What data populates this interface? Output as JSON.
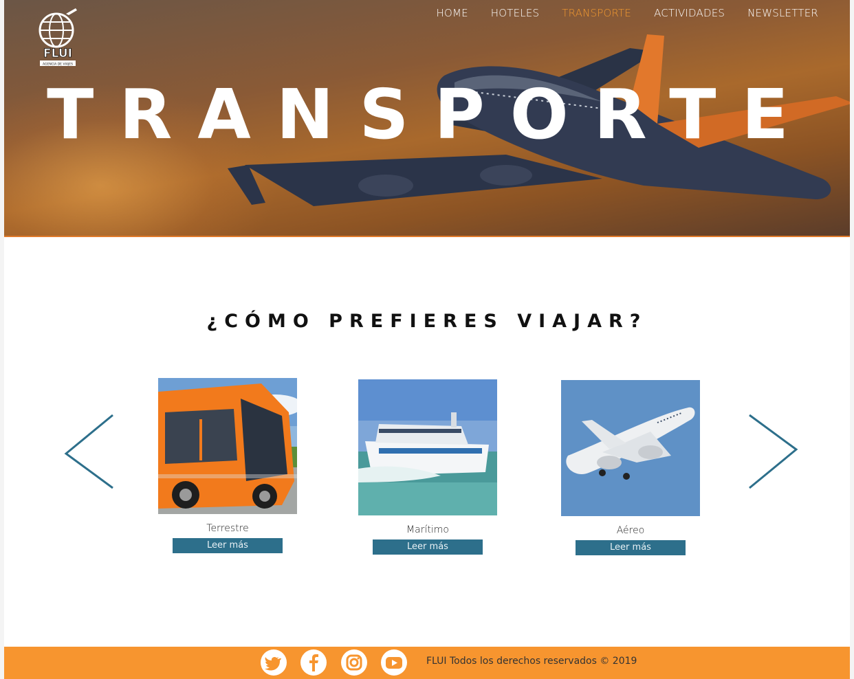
{
  "brand": {
    "name": "FLUI",
    "tagline": "AGENCIA DE VIAJES"
  },
  "nav": {
    "items": [
      {
        "label": "HOME"
      },
      {
        "label": "HOTELES"
      },
      {
        "label": "TRANSPORTE"
      },
      {
        "label": "ACTIVIDADES"
      },
      {
        "label": "NEWSLETTER"
      }
    ],
    "active_color": "#f39a30"
  },
  "hero": {
    "title": "TRANSPORTE"
  },
  "section": {
    "title": "¿CÓMO PREFIERES VIAJAR?"
  },
  "cards": [
    {
      "label": "Terrestre",
      "button": "Leer más",
      "image": "bus-photo"
    },
    {
      "label": "Marítimo",
      "button": "Leer más",
      "image": "ferry-photo"
    },
    {
      "label": "Aéreo",
      "button": "Leer más",
      "image": "airplane-photo"
    }
  ],
  "carousel": {
    "prev_icon": "chevron-left-icon",
    "next_icon": "chevron-right-icon",
    "arrow_color": "#2d6f8b"
  },
  "footer": {
    "social": [
      "twitter-icon",
      "facebook-icon",
      "instagram-icon",
      "youtube-icon"
    ],
    "copyright": "FLUI  Todos los derechos reservados © 2019",
    "background": "#f7952f"
  }
}
